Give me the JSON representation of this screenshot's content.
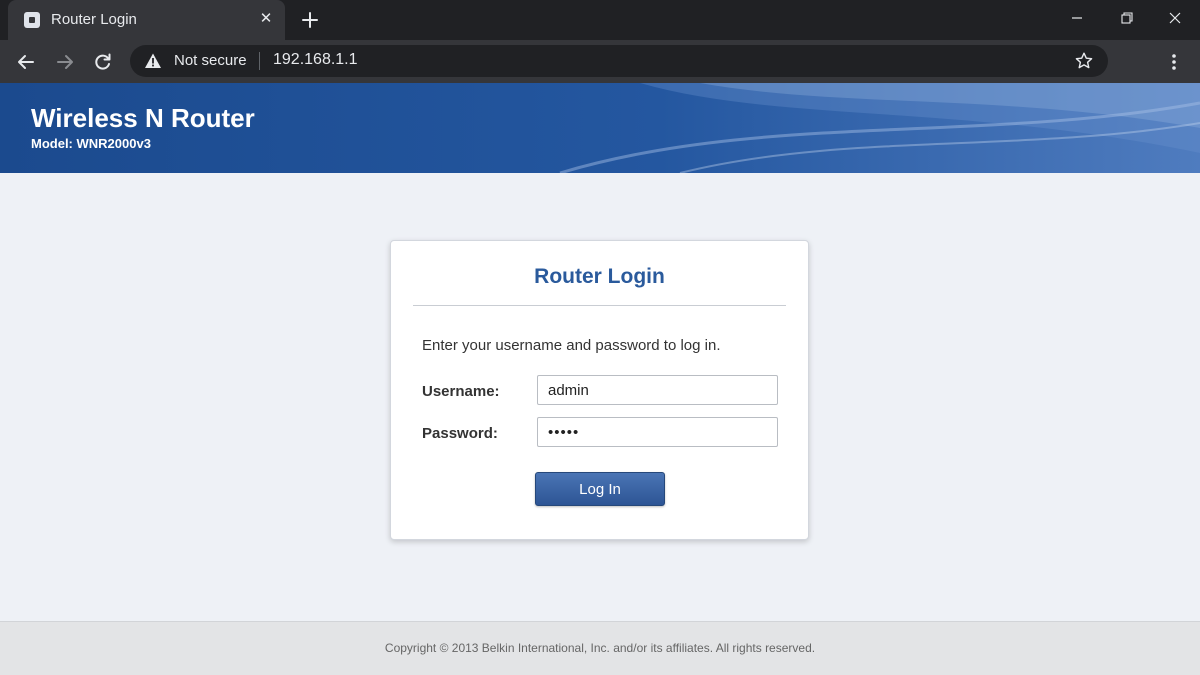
{
  "browser": {
    "tab": {
      "title": "Router Login",
      "favicon": "router-page-favicon"
    },
    "address_bar": {
      "security_label": "Not secure",
      "url": "192.168.1.1"
    },
    "icons": [
      "back-arrow-icon",
      "forward-arrow-icon",
      "reload-icon",
      "warning-icon",
      "star-icon",
      "kebab-menu-icon",
      "plus-icon",
      "close-icon",
      "minimize-icon",
      "restore-icon"
    ]
  },
  "header": {
    "title": "Wireless N Router",
    "model": "Model: WNR2000v3",
    "background_color": "#1d4e93"
  },
  "login": {
    "title": "Router Login",
    "instructions": "Enter your username and password to log in.",
    "username_label": "Username:",
    "username_value": "admin",
    "password_label": "Password:",
    "password_value": "•••••",
    "button_label": "Log In",
    "accent_color": "#2a5a9c"
  },
  "footer": {
    "copyright": "Copyright © 2013 Belkin International, Inc. and/or its affiliates. All rights reserved."
  }
}
